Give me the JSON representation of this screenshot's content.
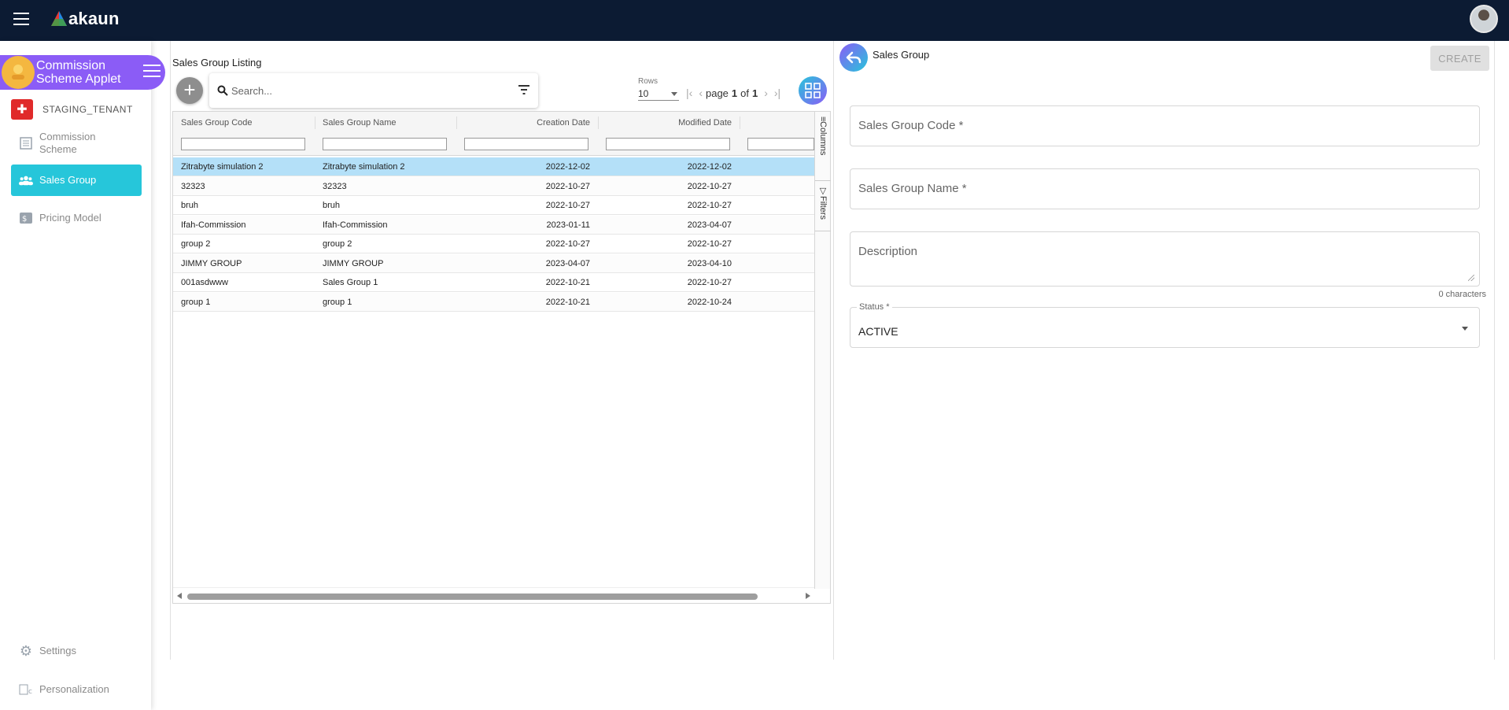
{
  "app": {
    "logo_text": "akaun"
  },
  "sidebar": {
    "applet_title": "Commission Scheme Applet",
    "tenant": "STAGING_TENANT",
    "items": [
      {
        "label": "Commission Scheme",
        "icon": "list-icon",
        "active": false
      },
      {
        "label": "Sales Group",
        "icon": "group-icon",
        "active": true
      },
      {
        "label": "Pricing Model",
        "icon": "dollar-icon",
        "active": false
      }
    ],
    "bottom_items": [
      {
        "label": "Settings",
        "icon": "gear-icon"
      },
      {
        "label": "Personalization",
        "icon": "broken-image-icon"
      }
    ]
  },
  "listing": {
    "title": "Sales Group Listing",
    "search_placeholder": "Search...",
    "rows_label": "Rows",
    "rows_value": "10",
    "pager": {
      "page_word": "page",
      "current": "1",
      "of_word": "of",
      "total": "1"
    },
    "columns": [
      "Sales Group Code",
      "Sales Group Name",
      "Creation Date",
      "Modified Date"
    ],
    "side_tabs": [
      "Columns",
      "Filters"
    ],
    "rows": [
      {
        "code": "Zitrabyte simulation 2",
        "name": "Zitrabyte simulation 2",
        "created": "2022-12-02",
        "modified": "2022-12-02",
        "selected": true
      },
      {
        "code": "32323",
        "name": "32323",
        "created": "2022-10-27",
        "modified": "2022-10-27"
      },
      {
        "code": "bruh",
        "name": "bruh",
        "created": "2022-10-27",
        "modified": "2022-10-27"
      },
      {
        "code": "Ifah-Commission",
        "name": "Ifah-Commission",
        "created": "2023-01-11",
        "modified": "2023-04-07"
      },
      {
        "code": "group 2",
        "name": "group 2",
        "created": "2022-10-27",
        "modified": "2022-10-27"
      },
      {
        "code": "JIMMY GROUP",
        "name": "JIMMY GROUP",
        "created": "2023-04-07",
        "modified": "2023-04-10"
      },
      {
        "code": "001asdwww",
        "name": "Sales Group 1",
        "created": "2022-10-21",
        "modified": "2022-10-27"
      },
      {
        "code": "group 1",
        "name": "group 1",
        "created": "2022-10-21",
        "modified": "2022-10-24"
      }
    ]
  },
  "form": {
    "title": "Sales Group",
    "create_label": "CREATE",
    "code_label": "Sales Group Code *",
    "name_label": "Sales Group Name *",
    "description_label": "Description",
    "char_count": "0 characters",
    "status_label": "Status *",
    "status_value": "ACTIVE"
  },
  "colors": {
    "topbar": "#0c1b33",
    "accent_purple": "#8b5cf6",
    "accent_cyan": "#26c6da",
    "selected_row": "#b4e0f8"
  }
}
